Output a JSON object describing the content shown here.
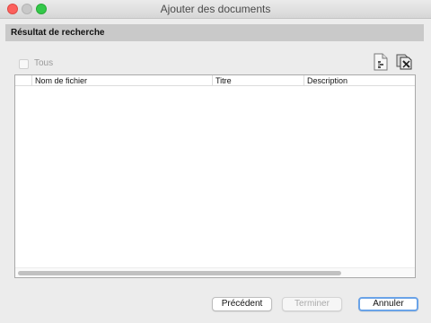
{
  "window": {
    "title": "Ajouter des documents"
  },
  "section": {
    "title": "Résultat de recherche"
  },
  "select_all": {
    "label": "Tous",
    "checked": false,
    "enabled": false
  },
  "toolbar": {
    "icons": [
      "add-file-icon",
      "copy-files-icon"
    ]
  },
  "table": {
    "columns": [
      "",
      "Nom de fichier",
      "Titre",
      "Description"
    ],
    "rows": []
  },
  "buttons": {
    "previous": "Précédent",
    "finish": "Terminer",
    "cancel": "Annuler"
  },
  "colors": {
    "close": "#fc605c",
    "minimize": "#c8c8c8",
    "zoom": "#34c84a",
    "focus_ring": "#6aa3e8",
    "section_bg": "#c9c9c9"
  }
}
